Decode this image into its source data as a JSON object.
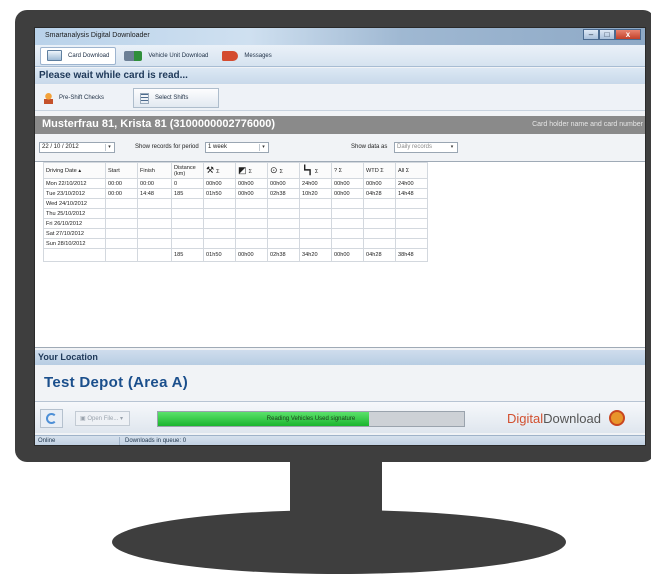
{
  "window": {
    "title": "Smartanalysis Digital Downloader"
  },
  "tabs": [
    {
      "label": "Card Download",
      "icon": "card-reader-icon"
    },
    {
      "label": "Vehicle Unit Download",
      "icon": "truck-icon"
    },
    {
      "label": "Messages",
      "icon": "megaphone-icon"
    }
  ],
  "status_banner": "Please wait while card is read...",
  "actions": {
    "pre_shift": "Pre-Shift Checks",
    "select_shifts": "Select Shifts"
  },
  "card": {
    "holder": "Musterfrau 81, Krista 81 (3100000002776000)",
    "hint": "Card holder name and card number"
  },
  "controls": {
    "date": "22 / 10 / 2012",
    "period_label": "Show records for period",
    "period_value": "1 week",
    "show_as_label": "Show data as",
    "show_as_value": "Daily records"
  },
  "table": {
    "headers": [
      "Driving Date",
      "Start",
      "Finish",
      "Distance (km)",
      "Σ",
      "Σ",
      "Σ",
      "Σ",
      "? Σ",
      "WTD Σ",
      "All Σ"
    ],
    "rows": [
      [
        "Mon 22/10/2012",
        "00:00",
        "00:00",
        "0",
        "00h00",
        "00h00",
        "00h00",
        "24h00",
        "00h00",
        "00h00",
        "24h00"
      ],
      [
        "Tue 23/10/2012",
        "00:00",
        "14:48",
        "185",
        "01h50",
        "00h00",
        "02h38",
        "10h20",
        "00h00",
        "04h28",
        "14h48"
      ],
      [
        "Wed 24/10/2012",
        "",
        "",
        "",
        "",
        "",
        "",
        "",
        "",
        "",
        ""
      ],
      [
        "Thu 25/10/2012",
        "",
        "",
        "",
        "",
        "",
        "",
        "",
        "",
        "",
        ""
      ],
      [
        "Fri 26/10/2012",
        "",
        "",
        "",
        "",
        "",
        "",
        "",
        "",
        "",
        ""
      ],
      [
        "Sat 27/10/2012",
        "",
        "",
        "",
        "",
        "",
        "",
        "",
        "",
        "",
        ""
      ],
      [
        "Sun 28/10/2012",
        "",
        "",
        "",
        "",
        "",
        "",
        "",
        "",
        "",
        ""
      ]
    ],
    "totals": [
      "",
      "",
      "",
      "185",
      "01h50",
      "00h00",
      "02h38",
      "34h20",
      "00h00",
      "04h28",
      "38h48"
    ]
  },
  "location": {
    "heading": "Your Location",
    "value": "Test Depot (Area A)"
  },
  "bottom": {
    "open_file": "Open File...",
    "progress_text": "Reading Vehicles Used signature",
    "progress_fraction": 0.69,
    "brand_a": "Digital",
    "brand_b": "Download"
  },
  "statusbar": {
    "state": "Online",
    "queue": "Downloads in queue: 0"
  }
}
